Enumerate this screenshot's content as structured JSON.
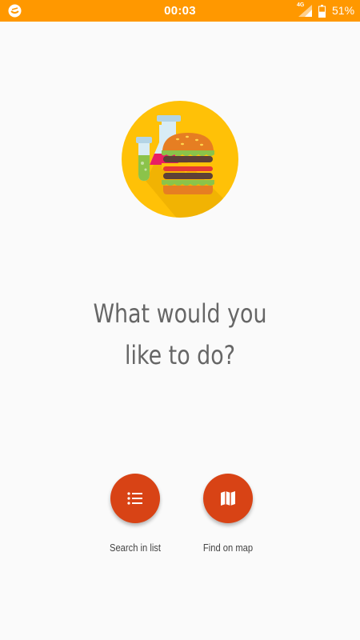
{
  "status_bar": {
    "time": "00:03",
    "network": "4G",
    "battery": "51%",
    "battery_level": 0.51,
    "background_color": "#ff9800"
  },
  "main": {
    "hero_image": "burger-and-test-tubes-illustration",
    "question_line1": "What would you",
    "question_line2": "like to do?"
  },
  "actions": {
    "search_in_list": {
      "label": "Search in list",
      "icon": "list-icon"
    },
    "find_on_map": {
      "label": "Find on map",
      "icon": "map-icon"
    },
    "button_color": "#d84315"
  }
}
